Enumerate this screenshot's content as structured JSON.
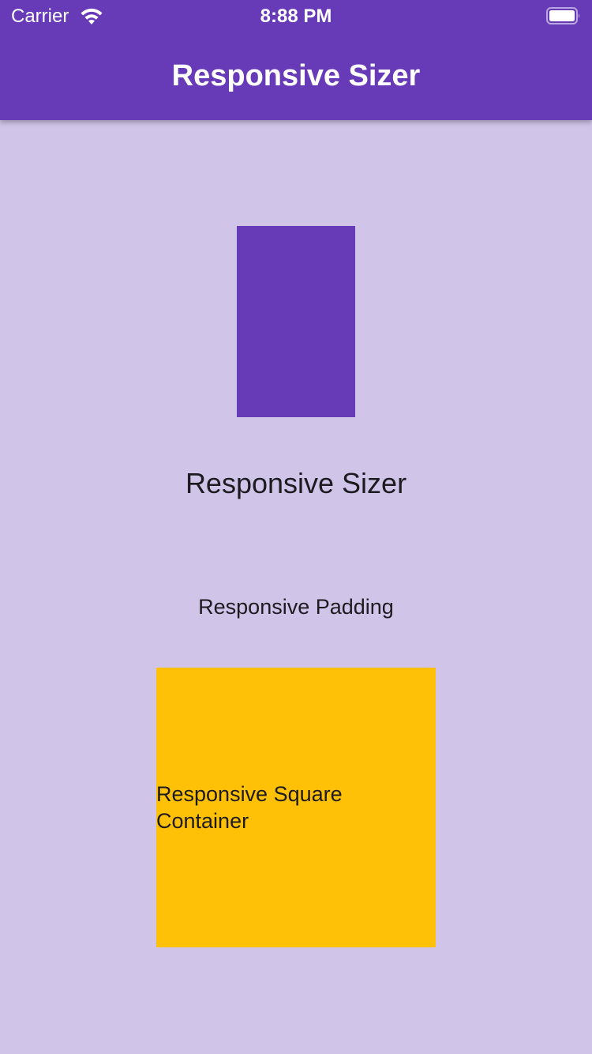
{
  "status_bar": {
    "carrier": "Carrier",
    "time": "8:88 PM",
    "wifi_icon": "wifi-icon",
    "battery_icon": "battery-icon"
  },
  "app_bar": {
    "title": "Responsive Sizer",
    "color": "#673AB7"
  },
  "main": {
    "background": "#D1C4E9",
    "box_color": "#673AB7",
    "sizer_text": "Responsive Sizer",
    "padding_text": "Responsive Padding",
    "square": {
      "color": "#FFC107",
      "text": "Responsive Square Container"
    }
  }
}
